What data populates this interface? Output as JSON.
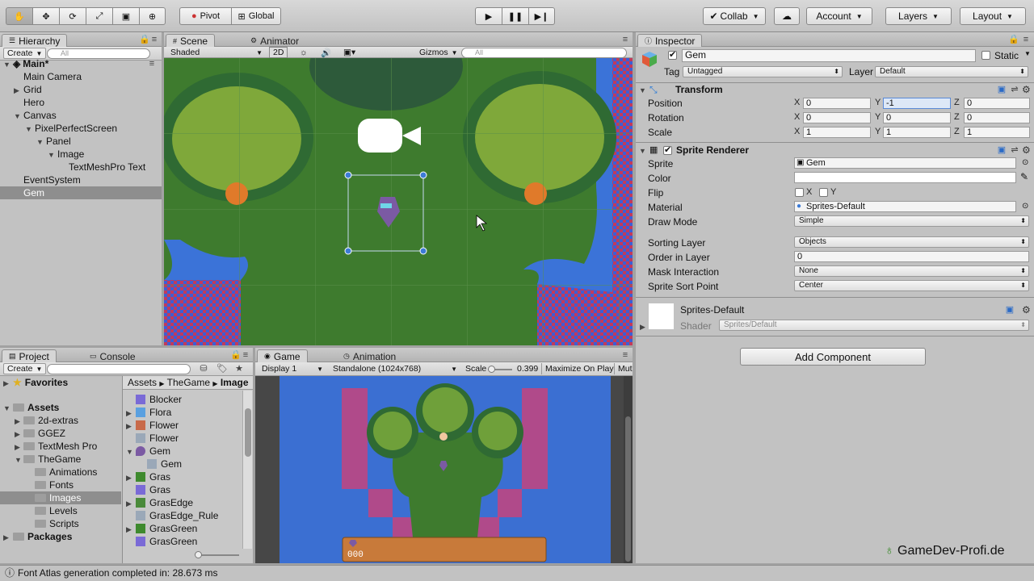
{
  "toolbar": {
    "pivot": "Pivot",
    "global": "Global",
    "collab": "Collab",
    "account": "Account",
    "layers": "Layers",
    "layout": "Layout"
  },
  "hierarchy": {
    "tab": "Hierarchy",
    "create": "Create",
    "search_placeholder": "All",
    "scene": "Main*",
    "items": [
      "Main Camera",
      "Grid",
      "Hero",
      "Canvas",
      "PixelPerfectScreen",
      "Panel",
      "Image",
      "TextMeshPro Text",
      "EventSystem",
      "Gem"
    ]
  },
  "scene": {
    "tabs": [
      "Scene",
      "Animator"
    ],
    "shading": "Shaded",
    "mode2d": "2D",
    "gizmos": "Gizmos",
    "search_placeholder": "All"
  },
  "inspector": {
    "tab": "Inspector",
    "name": "Gem",
    "static": "Static",
    "tag_label": "Tag",
    "tag": "Untagged",
    "layer_label": "Layer",
    "layer": "Default",
    "transform": {
      "title": "Transform",
      "position": "Position",
      "rotation": "Rotation",
      "scale": "Scale",
      "pos": [
        "0",
        "-1",
        "0"
      ],
      "rot": [
        "0",
        "0",
        "0"
      ],
      "scl": [
        "1",
        "1",
        "1"
      ],
      "axes": [
        "X",
        "Y",
        "Z"
      ]
    },
    "sprite_renderer": {
      "title": "Sprite Renderer",
      "sprite_label": "Sprite",
      "sprite": "Gem",
      "color_label": "Color",
      "flip_label": "Flip",
      "flip_x": "X",
      "flip_y": "Y",
      "material_label": "Material",
      "material": "Sprites-Default",
      "draw_mode_label": "Draw Mode",
      "draw_mode": "Simple",
      "sorting_layer_label": "Sorting Layer",
      "sorting_layer": "Objects",
      "order_label": "Order in Layer",
      "order": "0",
      "mask_label": "Mask Interaction",
      "mask": "None",
      "sort_point_label": "Sprite Sort Point",
      "sort_point": "Center"
    },
    "material": {
      "name": "Sprites-Default",
      "shader_label": "Shader",
      "shader": "Sprites/Default"
    },
    "add_component": "Add Component"
  },
  "project": {
    "tabs": [
      "Project",
      "Console"
    ],
    "create": "Create",
    "favorites": "Favorites",
    "assets": "Assets",
    "folders": [
      "2d-extras",
      "GGEZ",
      "TextMesh Pro",
      "TheGame",
      "Animations",
      "Fonts",
      "Images",
      "Levels",
      "Scripts"
    ],
    "packages": "Packages",
    "breadcrumb": [
      "Assets",
      "TheGame",
      "Image"
    ],
    "files": [
      "Blocker",
      "Flora",
      "Flower",
      "Flower",
      "Gem",
      "Gem",
      "Gras",
      "Gras",
      "GrasEdge",
      "GrasEdge_Rule",
      "GrasGreen",
      "GrasGreen"
    ]
  },
  "game": {
    "tabs": [
      "Game",
      "Animation"
    ],
    "display": "Display 1",
    "resolution": "Standalone (1024x768)",
    "scale_label": "Scale",
    "scale": "0.399",
    "maximize": "Maximize On Play",
    "mute": "Mut",
    "coins": "000"
  },
  "status": {
    "message": "Font Atlas generation completed in: 28.673 ms"
  },
  "watermark": "GameDev-Profi.de",
  "colors": {
    "grass": "#3b7a2c",
    "water": "#3b73d8",
    "selection": "#3d7bd6"
  }
}
